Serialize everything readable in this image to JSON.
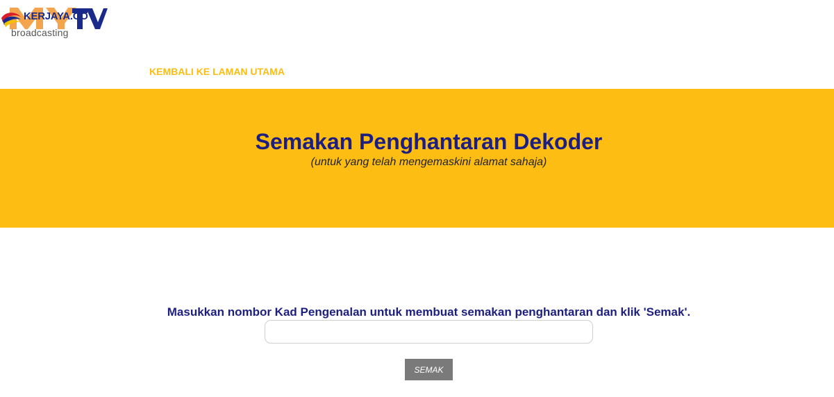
{
  "header": {
    "logo": {
      "brand_top": "KERJAYA.CO",
      "brand_mark": "MYTV",
      "brand_sub": "broadcasting"
    },
    "nav_link_label": "KEMBALI KE LAMAN UTAMA"
  },
  "banner": {
    "title": "Semakan Penghantaran Dekoder",
    "subtitle": "(untuk yang telah mengemaskini alamat sahaja)",
    "background_color": "#fdbd12",
    "title_color": "#1c1f80"
  },
  "form": {
    "instruction": "Masukkan nombor Kad Pengenalan untuk membuat semakan penghantaran dan klik 'Semak'.",
    "ic_input": {
      "value": "",
      "placeholder": ""
    },
    "submit_label": "SEMAK",
    "submit_color": "#7a7a7a"
  },
  "colors": {
    "accent_yellow": "#fbbd12",
    "text_navy": "#1c1f80"
  }
}
